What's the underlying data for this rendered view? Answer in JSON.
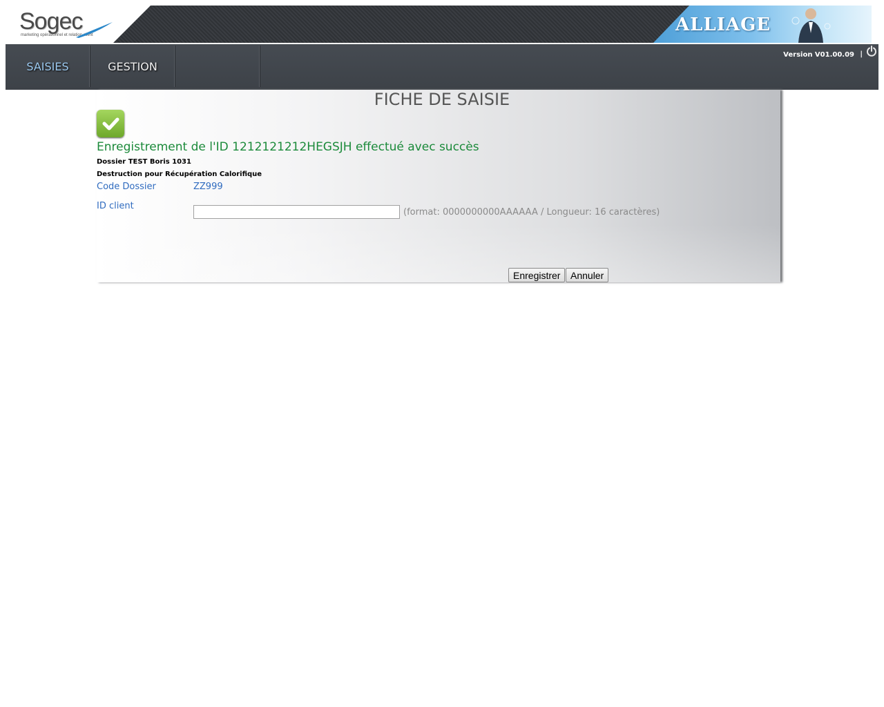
{
  "header": {
    "logo_text": "Sogec",
    "logo_tagline": "marketing opérationnel et relation client",
    "product_name": "ALLIAGE"
  },
  "nav": {
    "tabs": [
      {
        "label": "SAISIES",
        "active": true
      },
      {
        "label": "GESTION",
        "active": false
      },
      {
        "label": "",
        "active": false
      }
    ],
    "version": "Version V01.00.09",
    "separator": "|",
    "logout_icon": "power-icon"
  },
  "main": {
    "title": "FICHE DE SAISIE",
    "success_icon": "checkmark-icon",
    "success_message": "Enregistrement de l'ID 1212121212HEGSJH effectué avec succès",
    "dossier_name": "Dossier TEST Boris 1031",
    "dossier_description": "Destruction pour Récupération Calorifique",
    "code_dossier": {
      "label": "Code Dossier",
      "value": "ZZ999"
    },
    "id_client": {
      "label": "ID client",
      "value": "",
      "hint": "(format: 0000000000AAAAAA / Longueur: 16 caractères)"
    },
    "buttons": {
      "save": "Enregistrer",
      "cancel": "Annuler"
    }
  },
  "colors": {
    "success_green": "#1b8a3a",
    "label_blue": "#2f6bbf",
    "nav_active": "#9cc9ef",
    "nav_bg": "#42474d"
  }
}
